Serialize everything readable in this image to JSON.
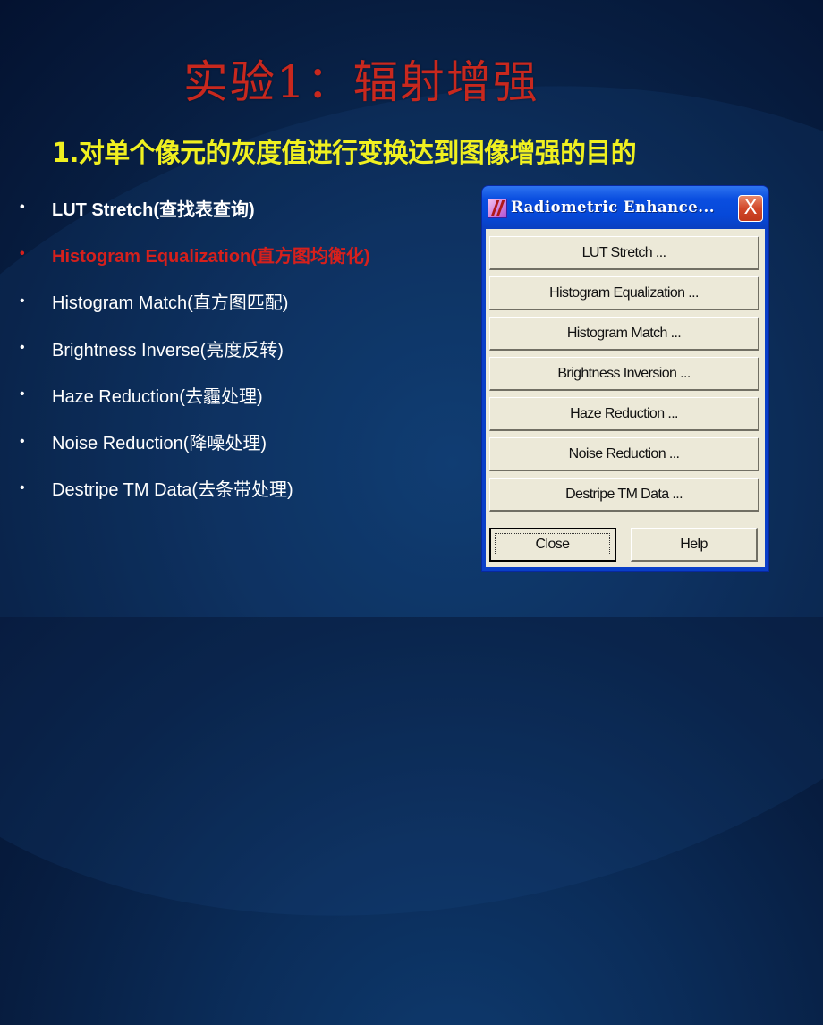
{
  "slide": {
    "title": "实验1：辐射增强",
    "subtitle": "1.对单个像元的灰度值进行变换达到图像增强的目的",
    "bullet_symbol": "•",
    "bullets": [
      {
        "label": "LUT Stretch(查找表查询)",
        "style": "bold"
      },
      {
        "label": "Histogram Equalization(直方图均衡化)",
        "style": "highlight"
      },
      {
        "label": "Histogram Match(直方图匹配)",
        "style": "normal"
      },
      {
        "label": "Brightness Inverse(亮度反转)",
        "style": "normal"
      },
      {
        "label": "Haze Reduction(去霾处理)",
        "style": "normal"
      },
      {
        "label": "Noise Reduction(降噪处理)",
        "style": "normal"
      },
      {
        "label": "Destripe TM Data(去条带处理)",
        "style": "normal"
      }
    ],
    "colors": {
      "title": "#c8281e",
      "subtitle": "#f0f020",
      "highlight": "#d6201c",
      "background": "#0b2d5a"
    }
  },
  "dialog": {
    "title": "Radiometric Enhance...",
    "app_icon": "erdas-imagine-icon",
    "close_glyph": "X",
    "buttons": [
      "LUT Stretch ...",
      "Histogram Equalization ...",
      "Histogram Match ...",
      "Brightness Inversion ...",
      "Haze Reduction ...",
      "Noise Reduction ...",
      "Destripe TM Data ..."
    ],
    "close_label": "Close",
    "help_label": "Help"
  }
}
